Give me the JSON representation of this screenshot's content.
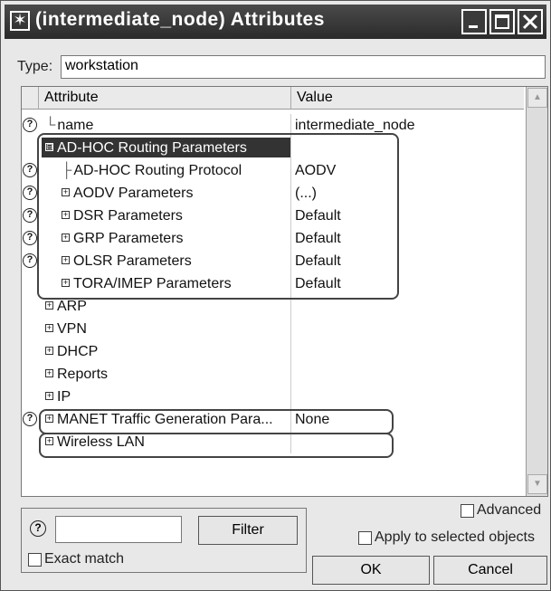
{
  "window": {
    "title": "(intermediate_node) Attributes",
    "minimize": "_",
    "maximize": "□",
    "close": "✕",
    "title_icon": "✶"
  },
  "type_label": "Type:",
  "type_value": "workstation",
  "columns": {
    "attribute": "Attribute",
    "value": "Value"
  },
  "rows": [
    {
      "attr": "name",
      "value": "intermediate_node",
      "help": true,
      "prefix": "└",
      "expand": ""
    },
    {
      "attr": "AD-HOC Routing Parameters",
      "value": "",
      "help": false,
      "expand": "⊟",
      "selected": true
    },
    {
      "attr": "AD-HOC Routing Protocol",
      "value": "AODV",
      "help": true,
      "prefix": "├",
      "expand": ""
    },
    {
      "attr": "AODV Parameters",
      "value": "(...)",
      "help": true,
      "expand": "+"
    },
    {
      "attr": "DSR Parameters",
      "value": "Default",
      "help": true,
      "expand": "+"
    },
    {
      "attr": "GRP Parameters",
      "value": "Default",
      "help": true,
      "expand": "+"
    },
    {
      "attr": "OLSR Parameters",
      "value": "Default",
      "help": true,
      "expand": "+"
    },
    {
      "attr": "TORA/IMEP Parameters",
      "value": "Default",
      "help": false,
      "expand": "+"
    },
    {
      "attr": "ARP",
      "value": "",
      "help": false,
      "expand": "+"
    },
    {
      "attr": "VPN",
      "value": "",
      "help": false,
      "expand": "+"
    },
    {
      "attr": "DHCP",
      "value": "",
      "help": false,
      "expand": "+"
    },
    {
      "attr": "Reports",
      "value": "",
      "help": false,
      "expand": "+"
    },
    {
      "attr": "IP",
      "value": "",
      "help": false,
      "expand": "+"
    },
    {
      "attr": "MANET Traffic Generation Para...",
      "value": "None",
      "help": true,
      "expand": "+"
    },
    {
      "attr": "Wireless LAN",
      "value": "",
      "help": false,
      "expand": "+"
    }
  ],
  "help_glyph": "?",
  "advanced_label": "Advanced",
  "filter_button": "Filter",
  "exact_match_label": "Exact match",
  "apply_label": "Apply to selected objects",
  "ok_button": "OK",
  "cancel_button": "Cancel"
}
